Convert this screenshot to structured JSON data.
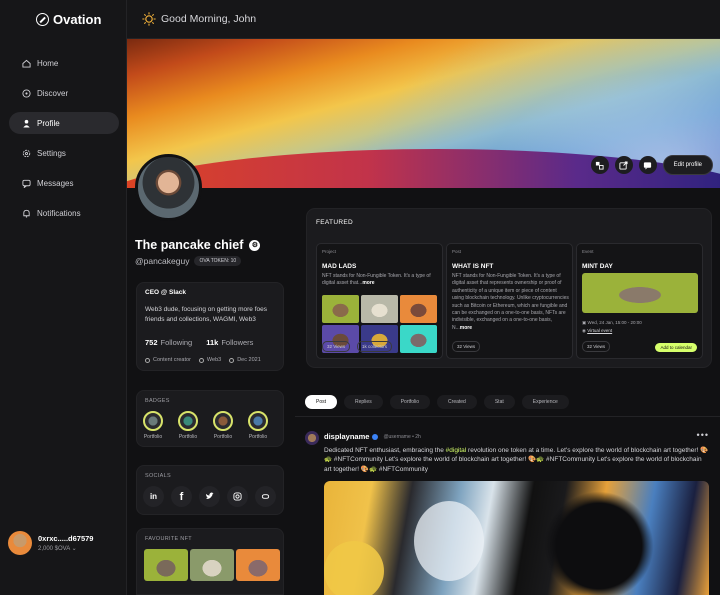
{
  "brand": {
    "name": "Ovation"
  },
  "greeting": "Good Morning, John",
  "sidebar": {
    "items": [
      {
        "label": "Home",
        "icon": "home-icon"
      },
      {
        "label": "Discover",
        "icon": "compass-icon"
      },
      {
        "label": "Profile",
        "icon": "user-icon",
        "active": true
      },
      {
        "label": "Settings",
        "icon": "gear-icon"
      },
      {
        "label": "Messages",
        "icon": "message-icon"
      },
      {
        "label": "Notifications",
        "icon": "bell-icon"
      }
    ],
    "wallet": {
      "address": "0xrxc.....d67579",
      "balance": "2,000 $OVA"
    }
  },
  "banner": {
    "edit_label": "Edit profile"
  },
  "profile": {
    "name": "The pancake chief",
    "handle": "@pancakeguy",
    "token_badge": "OVA TOKEN: 10",
    "role": "CEO @ Slack",
    "bio": "Web3 dude, focusing on getting more foes friends and collections, WAGMI, Web3",
    "following_count": "752",
    "following_label": "Following",
    "followers_count": "11k",
    "followers_label": "Followers",
    "meta": [
      "Content creator",
      "Web3",
      "Dec 2021"
    ]
  },
  "badges": {
    "title": "BADGES",
    "items": [
      "Portfolio",
      "Portfolio",
      "Portfolio",
      "Portfolio"
    ]
  },
  "socials": {
    "title": "SOCIALS",
    "items": [
      "in",
      "f",
      "t",
      "ig",
      "link"
    ]
  },
  "favourites": {
    "title": "FAVOURITE NFT"
  },
  "featured": {
    "title": "FEATURED",
    "cards": [
      {
        "category": "Project",
        "title": "MAD LADS",
        "desc": "NFT stands for Non-Fungible Token. It's a type of digital asset that...",
        "more": "more",
        "views": "32 Views",
        "collectors": "1k collectors"
      },
      {
        "category": "Post",
        "title": "WHAT IS NFT",
        "desc": "NFT stands for Non-Fungible Token. It's a type of digital asset that represents ownership or proof of authenticity of a unique item or piece of content using blockchain technology. Unlike cryptocurrencies such as Bitcoin or Ethereum, which are fungible and can be exchanged on a one-to-one basis, NFTs are indivisible, exchanged on a one-to-one basis, N...",
        "more": "more",
        "views": "32 Views"
      },
      {
        "category": "Event",
        "title": "MINT DAY",
        "date": "Wed, 24 Jan, 15:00 - 20:00",
        "location": "Virtual event",
        "views": "32 Views",
        "cta": "Add to calendar"
      }
    ]
  },
  "tabs": [
    "Post",
    "Replies",
    "Portfolio",
    "Created",
    "Stat",
    "Experience"
  ],
  "post": {
    "author": "displayname",
    "meta": "@username • 2h",
    "text_a": "Dedicated NFT enthusiast, embracing the ",
    "hashtag": "#digital",
    "text_b": " revolution one token at a time. Let's explore the world of blockchain art together! 🎨🐢 #NFTCommunity Let's explore the world of blockchain art together! 🎨🐢 #NFTCommunity Let's explore the world of blockchain art together! 🎨🐢 #NFTCommunity"
  },
  "colors": {
    "accent": "#d6ff6b",
    "background": "#111113",
    "panel": "#1b1b1e"
  }
}
